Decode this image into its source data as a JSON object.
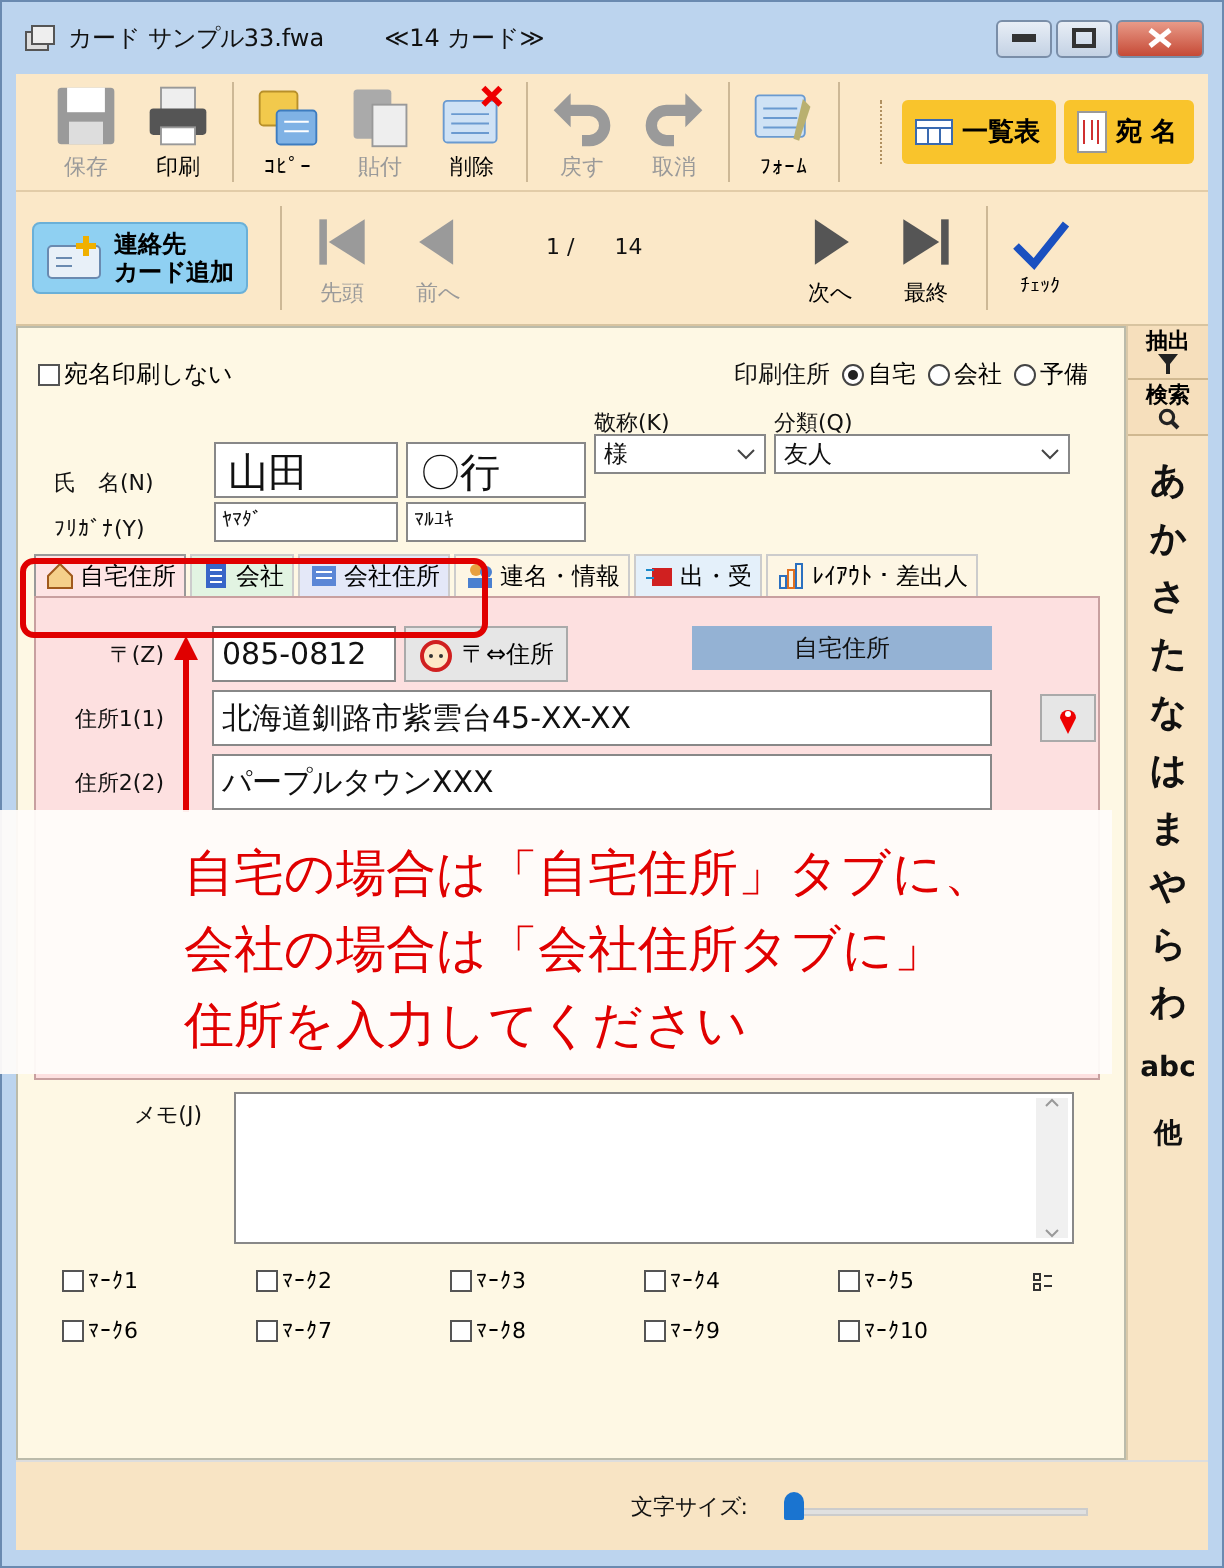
{
  "window": {
    "title": "カード サンプル33.fwa",
    "subtitle": "≪14 カード≫"
  },
  "toolbar": {
    "groups": [
      {
        "buttons": [
          {
            "kind": "save",
            "label": "保存",
            "disabled": true
          },
          {
            "kind": "print",
            "label": "印刷",
            "disabled": false
          }
        ]
      },
      {
        "buttons": [
          {
            "kind": "copy",
            "label": "ｺﾋﾟｰ",
            "disabled": false
          },
          {
            "kind": "paste",
            "label": "貼付",
            "disabled": true
          },
          {
            "kind": "delete",
            "label": "削除",
            "disabled": false
          }
        ]
      },
      {
        "buttons": [
          {
            "kind": "undo",
            "label": "戻す",
            "disabled": true
          },
          {
            "kind": "redo",
            "label": "取消",
            "disabled": true
          }
        ]
      },
      {
        "buttons": [
          {
            "kind": "form",
            "label": "ﾌｫｰﾑ",
            "disabled": false
          }
        ]
      }
    ],
    "views": [
      {
        "kind": "list",
        "label": "一覧表"
      },
      {
        "kind": "address",
        "label": "宛 名"
      }
    ]
  },
  "navbar": {
    "add_card": [
      "連絡先",
      "カード追加"
    ],
    "nav": [
      {
        "kind": "first",
        "label": "先頭",
        "disabled": true
      },
      {
        "kind": "prev",
        "label": "前へ",
        "disabled": true
      }
    ],
    "current": "1 /",
    "total": "14",
    "nav2": [
      {
        "kind": "next",
        "label": "次へ",
        "disabled": false
      },
      {
        "kind": "last",
        "label": "最終",
        "disabled": false
      }
    ],
    "check": "ﾁｪｯｸ"
  },
  "form": {
    "no_print": {
      "label": "宛名印刷しない",
      "checked": false
    },
    "print_address": {
      "label": "印刷住所",
      "options": [
        {
          "label": "自宅",
          "selected": true
        },
        {
          "label": "会社",
          "selected": false
        },
        {
          "label": "予備",
          "selected": false
        }
      ]
    },
    "name_label": "氏　名(N)",
    "last_name": "山田",
    "first_name": "〇行",
    "honorific": {
      "label": "敬称(K)",
      "value": "様"
    },
    "category": {
      "label": "分類(Q)",
      "value": "友人"
    },
    "kana_label": "ﾌﾘｶﾞﾅ(Y)",
    "kana_last": "ﾔﾏﾀﾞ",
    "kana_first": "ﾏﾙﾕｷ"
  },
  "tabs": [
    {
      "kind": "house",
      "label": "自宅住所",
      "selected": true,
      "color": "#fde4e4"
    },
    {
      "kind": "building",
      "label": "会社",
      "selected": false,
      "color": "#e2f4e2"
    },
    {
      "kind": "card",
      "label": "会社住所",
      "selected": false,
      "color": "#e4e8f8"
    },
    {
      "kind": "people",
      "label": "連名・情報",
      "selected": false,
      "color": "#fdf6e4"
    },
    {
      "kind": "mail",
      "label": "出・受",
      "selected": false,
      "color": "#e4f0fa"
    },
    {
      "kind": "chart",
      "label": "ﾚｲｱｳﾄ・差出人",
      "selected": false,
      "color": "#fdf6e4"
    }
  ],
  "address": {
    "zip_label": "〒(Z)",
    "zip": "085-0812",
    "convert_button": "〒⇔住所",
    "header": "自宅住所",
    "addr1_label": "住所1(1)",
    "addr1": "北海道釧路市紫雲台45-XX-XX",
    "addr2_label": "住所2(2)",
    "addr2": "パープルタウンXXX"
  },
  "memo_label": "メモ(J)",
  "marks": [
    {
      "label": "ﾏｰｸ1",
      "checked": false
    },
    {
      "label": "ﾏｰｸ2",
      "checked": false
    },
    {
      "label": "ﾏｰｸ3",
      "checked": false
    },
    {
      "label": "ﾏｰｸ4",
      "checked": false
    },
    {
      "label": "ﾏｰｸ5",
      "checked": false
    },
    {
      "label": "ﾏｰｸ6",
      "checked": false
    },
    {
      "label": "ﾏｰｸ7",
      "checked": false
    },
    {
      "label": "ﾏｰｸ8",
      "checked": false
    },
    {
      "label": "ﾏｰｸ9",
      "checked": false
    },
    {
      "label": "ﾏｰｸ10",
      "checked": false
    }
  ],
  "font_size": {
    "label": "文字サイズ:",
    "level": 0
  },
  "sidebar": {
    "extract": "抽出",
    "search": "検索",
    "index": [
      "あ",
      "か",
      "さ",
      "た",
      "な",
      "は",
      "ま",
      "や",
      "ら",
      "わ",
      "abc",
      "他"
    ]
  },
  "annotation": {
    "lines": [
      "自宅の場合は「自宅住所」タブに、",
      "会社の場合は「会社住所タブに」",
      "住所を入力してください"
    ]
  }
}
